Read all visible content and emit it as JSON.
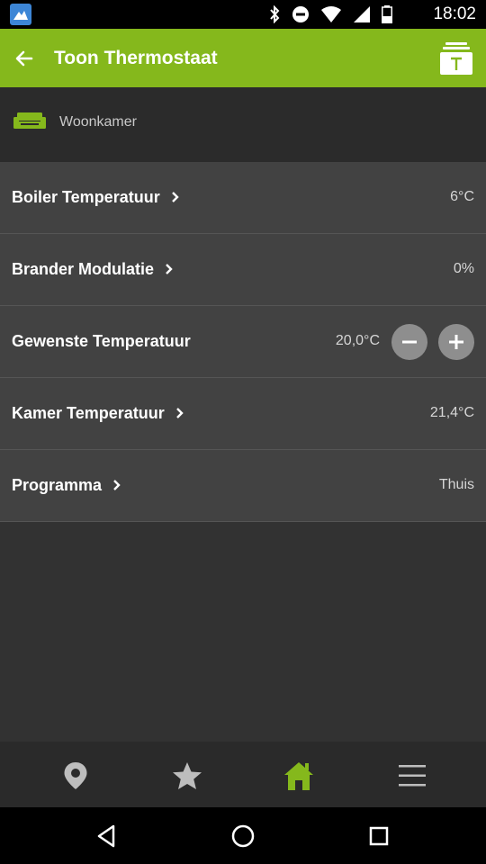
{
  "status_bar": {
    "time": "18:02",
    "icons": [
      "app-notification-icon",
      "bluetooth-icon",
      "do-not-disturb-icon",
      "wifi-icon",
      "signal-icon",
      "battery-icon"
    ]
  },
  "app_bar": {
    "title": "Toon Thermostaat",
    "color": "#85b81c"
  },
  "room": {
    "label": "Woonkamer",
    "icon": "sofa-icon",
    "icon_color": "#85b81c"
  },
  "rows": [
    {
      "label": "Boiler Temperatuur",
      "value": "6°C",
      "has_chevron": true
    },
    {
      "label": "Brander Modulatie",
      "value": "0%",
      "has_chevron": true
    },
    {
      "label": "Gewenste Temperatuur",
      "value": "20,0°C",
      "has_chevron": false
    },
    {
      "label": "Kamer Temperatuur",
      "value": "21,4°C",
      "has_chevron": true
    },
    {
      "label": "Programma",
      "value": "Thuis",
      "has_chevron": true
    }
  ],
  "bottom_nav": {
    "items": [
      "location-pin-icon",
      "star-icon",
      "home-icon",
      "menu-icon"
    ],
    "active": "home-icon",
    "active_color": "#85b81c",
    "inactive_color": "#bdbdbd"
  },
  "system_nav": [
    "back-icon",
    "home-circle-icon",
    "recents-icon"
  ]
}
